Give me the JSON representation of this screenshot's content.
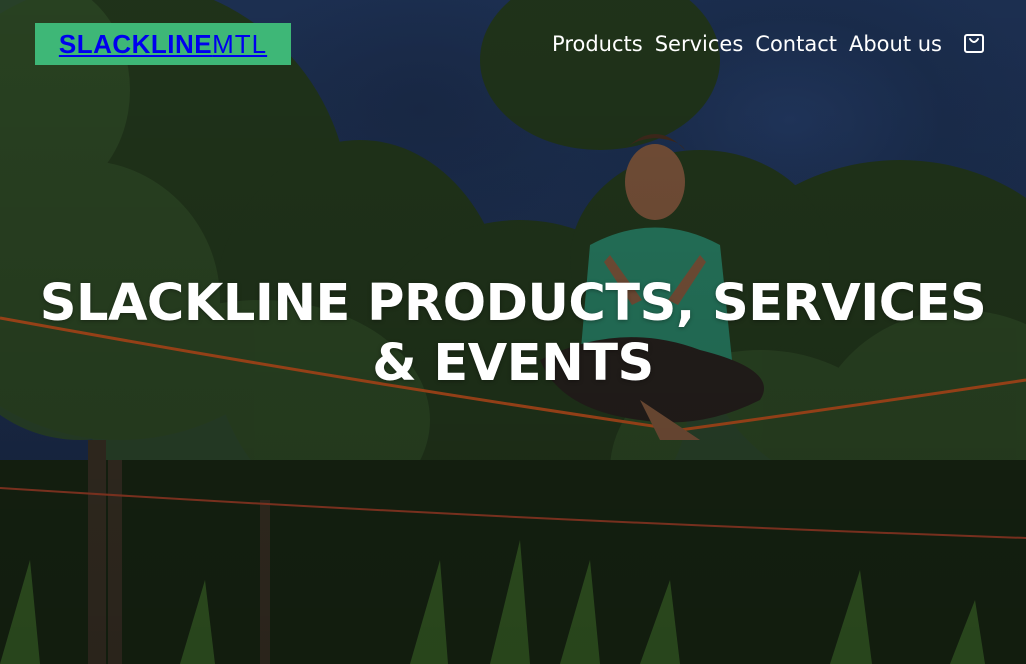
{
  "brand": {
    "logo_bold": "SLACKLINE",
    "logo_light": "MTL",
    "accent_color": "#3eb777"
  },
  "nav": {
    "items": [
      {
        "label": "Products"
      },
      {
        "label": "Services"
      },
      {
        "label": "Contact"
      },
      {
        "label": "About us"
      }
    ],
    "cart_icon": "shopping-bag-icon"
  },
  "hero": {
    "title_line1": "SLACKLINE PRODUCTS, SERVICES",
    "title_line2": "& EVENTS",
    "background": "photo of a person sitting cross-legged in meditation pose balancing on a slackline in a park with trees"
  }
}
